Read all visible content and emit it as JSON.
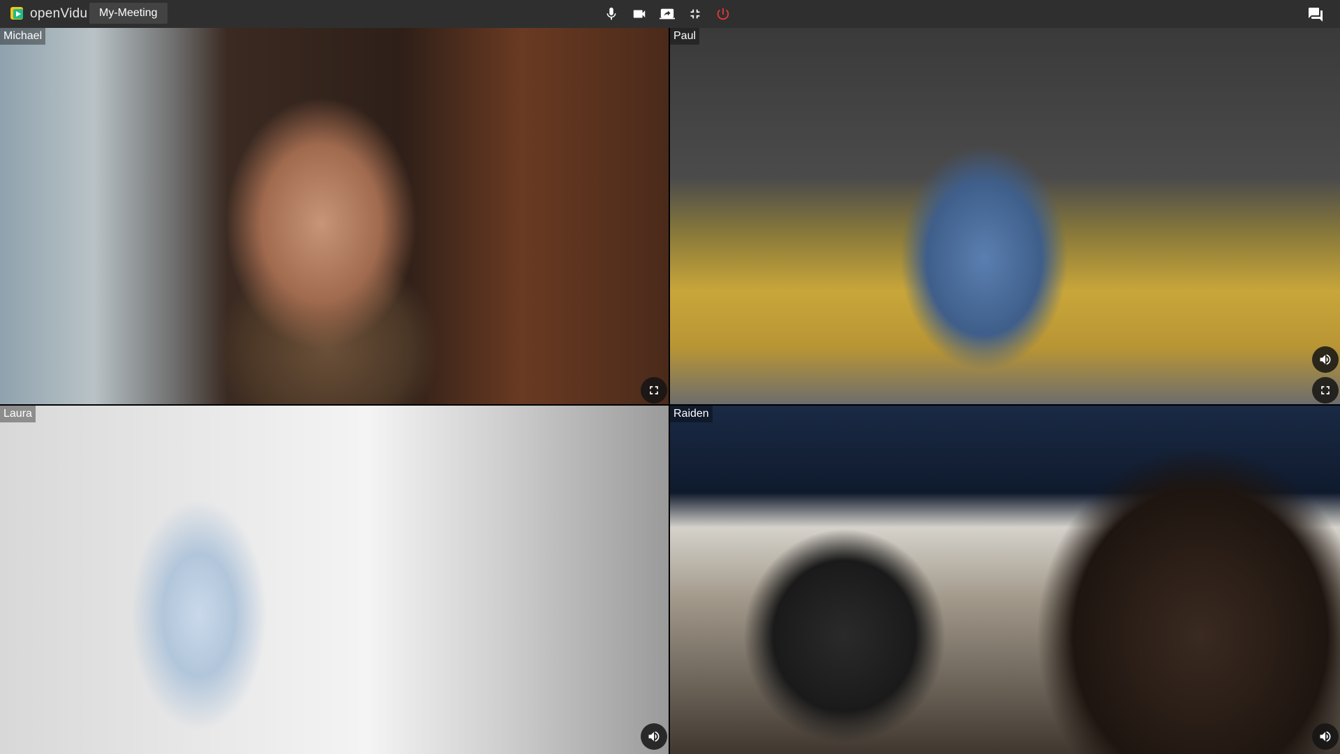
{
  "app": {
    "logo_text": "openVidu",
    "session_name": "My-Meeting"
  },
  "toolbar": {
    "controls": [
      "microphone-icon",
      "videocam-icon",
      "screen-share-icon",
      "exit-fullscreen-icon",
      "power-icon"
    ],
    "chat_icon": "chat-icon",
    "colors": {
      "background": "#2f2f2f",
      "leave": "#e53935",
      "icon": "#ffffff"
    }
  },
  "participants": [
    {
      "nickname": "Michael",
      "buttons": [
        "fullscreen-icon"
      ]
    },
    {
      "nickname": "Paul",
      "buttons": [
        "volume-icon",
        "fullscreen-icon"
      ]
    },
    {
      "nickname": "Laura",
      "buttons": [
        "volume-icon"
      ]
    },
    {
      "nickname": "Raiden",
      "buttons": [
        "volume-icon"
      ]
    }
  ]
}
